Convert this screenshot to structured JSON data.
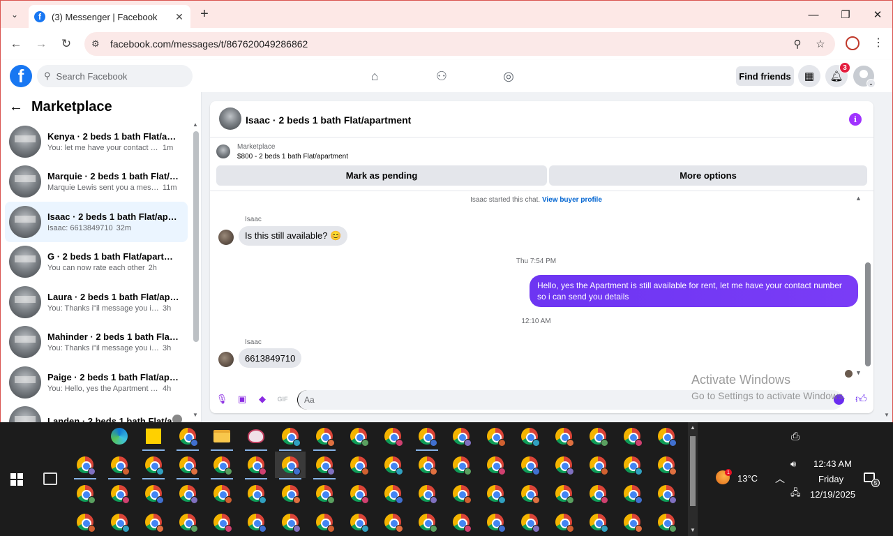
{
  "browser": {
    "tab_title": "(3) Messenger | Facebook",
    "tab_close": "✕",
    "new_tab": "+",
    "url": "facebook.com/messages/t/867620049286862",
    "window_controls": {
      "minimize": "—",
      "maximize": "❐",
      "close": "✕"
    }
  },
  "fb_header": {
    "logo_letter": "f",
    "search_placeholder": "Search Facebook",
    "find_friends": "Find friends",
    "notification_count": "3"
  },
  "sidebar": {
    "title": "Marketplace",
    "conversations": [
      {
        "name": "Kenya · 2 beds 1 bath Flat/apart...",
        "preview": "You: let me have your contact nu...",
        "time": "1m",
        "active": false
      },
      {
        "name": "Marquie · 2 beds 1 bath Flat/ap...",
        "preview": "Marquie Lewis sent you a messa...",
        "time": "11m",
        "active": false
      },
      {
        "name": "Isaac · 2 beds 1 bath Flat/apart...",
        "preview": "Isaac: 6613849710",
        "time": "32m",
        "active": true
      },
      {
        "name": "G · 2 beds 1 bath Flat/apartment",
        "preview": "You can now rate each other",
        "time": "2h",
        "active": false
      },
      {
        "name": "Laura · 2 beds 1 bath Flat/apart...",
        "preview": "You: Thanks i\"il message you in a ...",
        "time": "3h",
        "active": false
      },
      {
        "name": "Mahinder · 2 beds 1 bath Flat/a...",
        "preview": "You: Thanks i\"il message you in a ...",
        "time": "3h",
        "active": false
      },
      {
        "name": "Paige · 2 beds 1 bath Flat/apart...",
        "preview": "You: Hello, yes the Apartment is sti...",
        "time": "4h",
        "active": false
      },
      {
        "name": "Landen · 2 beds 1 bath Flat/a...",
        "preview": "",
        "time": "",
        "active": false
      }
    ]
  },
  "chat": {
    "title": "Isaac · 2 beds 1 bath Flat/apartment",
    "marketplace_label": "Marketplace",
    "listing": "$800 - 2 beds 1 bath Flat/apartment",
    "mark_pending": "Mark as pending",
    "more_options": "More options",
    "started_text": "Isaac started this chat.",
    "view_profile": "View buyer profile",
    "sender1": "Isaac",
    "msg1": "Is this still available? 😊",
    "time1": "Thu 7:54 PM",
    "msg2": "Hello, yes the Apartment is still available for rent, let me have your contact number so i can send you details",
    "time2": "12:10 AM",
    "sender2": "Isaac",
    "msg3": "6613849710",
    "composer_placeholder": "Aa"
  },
  "watermark": {
    "line1": "Activate Windows",
    "line2": "Go to Settings to activate Windows."
  },
  "taskbar": {
    "temperature": "13°C",
    "time": "12:43 AM",
    "day": "Friday",
    "date": "12/19/2025",
    "weather_badge": "1",
    "notification_count": "5"
  },
  "colors": {
    "facebook_blue": "#1877f2",
    "messenger_purple": "#7a3cf6",
    "active_conversation": "#ebf5ff",
    "taskbar": "#1c1c1c"
  }
}
